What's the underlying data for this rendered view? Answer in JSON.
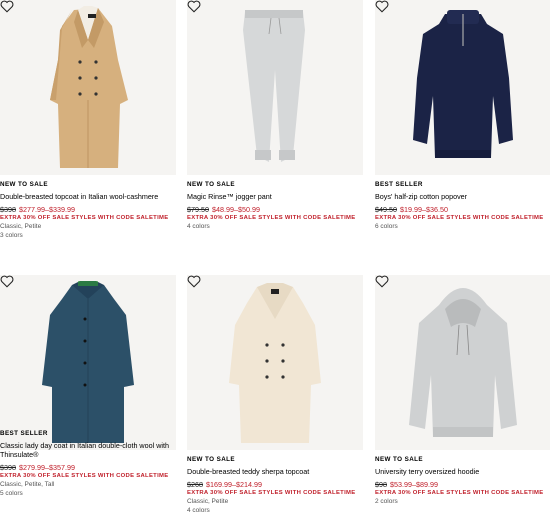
{
  "products": [
    {
      "badge": "NEW TO SALE",
      "name": "Double-breasted topcoat in Italian wool-cashmere",
      "orig": "$398",
      "sale": "$277.99–$339.99",
      "promo": "EXTRA 30% OFF SALE STYLES WITH CODE SALETIME",
      "fits": "Classic, Petite",
      "colors": "3 colors",
      "image": "camel-topcoat"
    },
    {
      "badge": "NEW TO SALE",
      "name": "Magic Rinse™ jogger pant",
      "orig": "$79.50",
      "sale": "$48.99–$50.99",
      "promo": "EXTRA 30% OFF SALE STYLES WITH CODE SALETIME",
      "fits": "",
      "colors": "4 colors",
      "image": "grey-jogger"
    },
    {
      "badge": "BEST SELLER",
      "name": "Boys' half-zip cotton popover",
      "orig": "$49.50",
      "sale": "$19.99–$36.50",
      "promo": "EXTRA 30% OFF SALE STYLES WITH CODE SALETIME",
      "fits": "",
      "colors": "6 colors",
      "image": "navy-popover"
    },
    {
      "badge": "BEST SELLER",
      "name": "Classic lady day coat in Italian double-cloth wool with Thinsulate®",
      "orig": "$398",
      "sale": "$279.99–$357.99",
      "promo": "EXTRA 30% OFF SALE STYLES WITH CODE SALETIME",
      "fits": "Classic, Petite, Tall",
      "colors": "5 colors",
      "image": "teal-coat"
    },
    {
      "badge": "NEW TO SALE",
      "name": "Double-breasted teddy sherpa topcoat",
      "orig": "$268",
      "sale": "$169.99–$214.99",
      "promo": "EXTRA 30% OFF SALE STYLES WITH CODE SALETIME",
      "fits": "Classic, Petite",
      "colors": "4 colors",
      "image": "cream-sherpa-coat"
    },
    {
      "badge": "NEW TO SALE",
      "name": "University terry oversized hoodie",
      "orig": "$98",
      "sale": "$53.99–$89.99",
      "promo": "EXTRA 30% OFF SALE STYLES WITH CODE SALETIME",
      "fits": "",
      "colors": "2 colors",
      "image": "grey-hoodie"
    }
  ],
  "icons": {
    "favorite": "heart-outline-icon"
  },
  "colors": {
    "sale": "#c0202b",
    "tile_bg": "#f5f4f2"
  }
}
